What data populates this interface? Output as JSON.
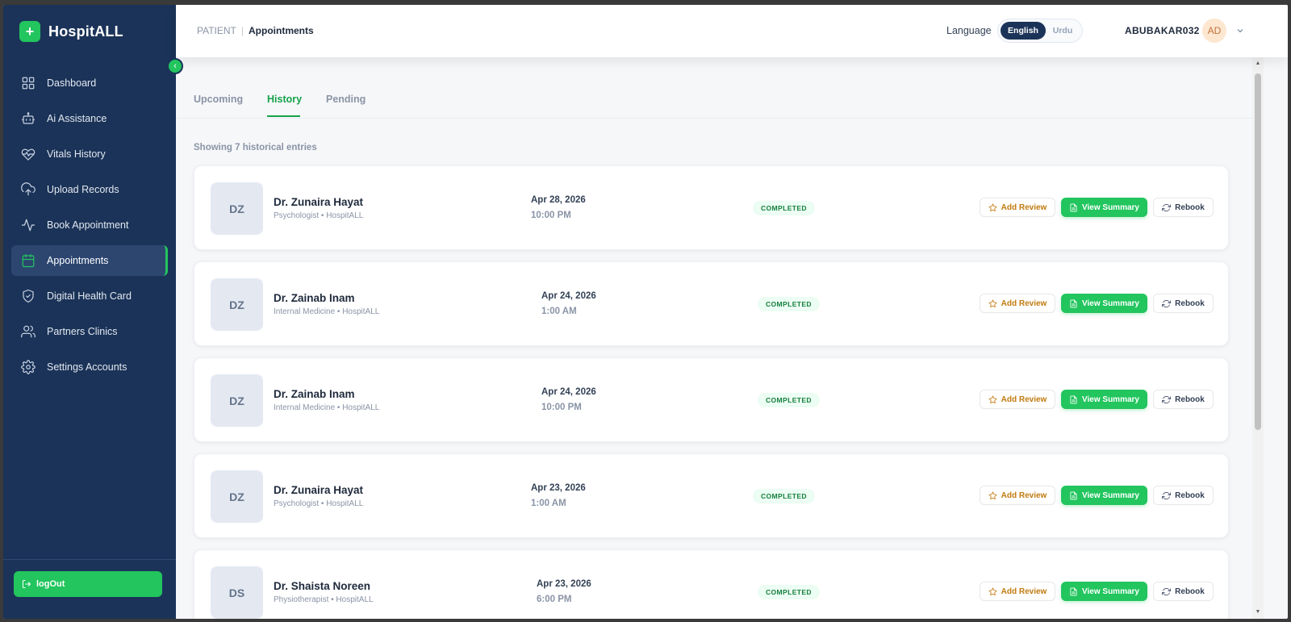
{
  "app": {
    "name": "HospitALL",
    "logo_symbol": "+"
  },
  "sidebar": {
    "items": [
      {
        "label": "Dashboard",
        "icon": "grid-icon"
      },
      {
        "label": "Ai Assistance",
        "icon": "bot-icon"
      },
      {
        "label": "Vitals History",
        "icon": "heart-pulse-icon"
      },
      {
        "label": "Upload Records",
        "icon": "cloud-upload-icon"
      },
      {
        "label": "Book Appointment",
        "icon": "activity-icon"
      },
      {
        "label": "Appointments",
        "icon": "calendar-icon",
        "active": true
      },
      {
        "label": "Digital Health Card",
        "icon": "shield-check-icon"
      },
      {
        "label": "Partners Clinics",
        "icon": "users-icon"
      },
      {
        "label": "Settings Accounts",
        "icon": "gear-icon"
      }
    ],
    "logout_label": "logOut"
  },
  "header": {
    "breadcrumb_root": "PATIENT",
    "breadcrumb_sep": "|",
    "breadcrumb_current": "Appointments",
    "language_label": "Language",
    "language_options": [
      "English",
      "Urdu"
    ],
    "language_selected": "English",
    "username": "ABUBAKAR032",
    "avatar_initials": "AD"
  },
  "tabs": {
    "items": [
      "Upcoming",
      "History",
      "Pending"
    ],
    "active": "History"
  },
  "showing_text": "Showing 7 historical entries",
  "buttons": {
    "review": "Add Review",
    "summary": "View Summary",
    "rebook": "Rebook"
  },
  "appointments": [
    {
      "initials": "DZ",
      "doctor": "Dr. Zunaira Hayat",
      "specialty": "Psychologist • HospitALL",
      "date": "Apr 28, 2026",
      "time": "10:00 PM",
      "status": "COMPLETED"
    },
    {
      "initials": "DZ",
      "doctor": "Dr. Zainab Inam",
      "specialty": "Internal Medicine • HospitALL",
      "date": "Apr 24, 2026",
      "time": "1:00 AM",
      "status": "COMPLETED"
    },
    {
      "initials": "DZ",
      "doctor": "Dr. Zainab Inam",
      "specialty": "Internal Medicine • HospitALL",
      "date": "Apr 24, 2026",
      "time": "10:00 PM",
      "status": "COMPLETED"
    },
    {
      "initials": "DZ",
      "doctor": "Dr. Zunaira Hayat",
      "specialty": "Psychologist • HospitALL",
      "date": "Apr 23, 2026",
      "time": "1:00 AM",
      "status": "COMPLETED"
    },
    {
      "initials": "DS",
      "doctor": "Dr. Shaista Noreen",
      "specialty": "Physiotherapist • HospitALL",
      "date": "Apr 23, 2026",
      "time": "6:00 PM",
      "status": "COMPLETED"
    }
  ],
  "colors": {
    "sidebar_bg": "#1b3358",
    "accent_green": "#22c55e",
    "review_amber": "#c27a0e"
  }
}
